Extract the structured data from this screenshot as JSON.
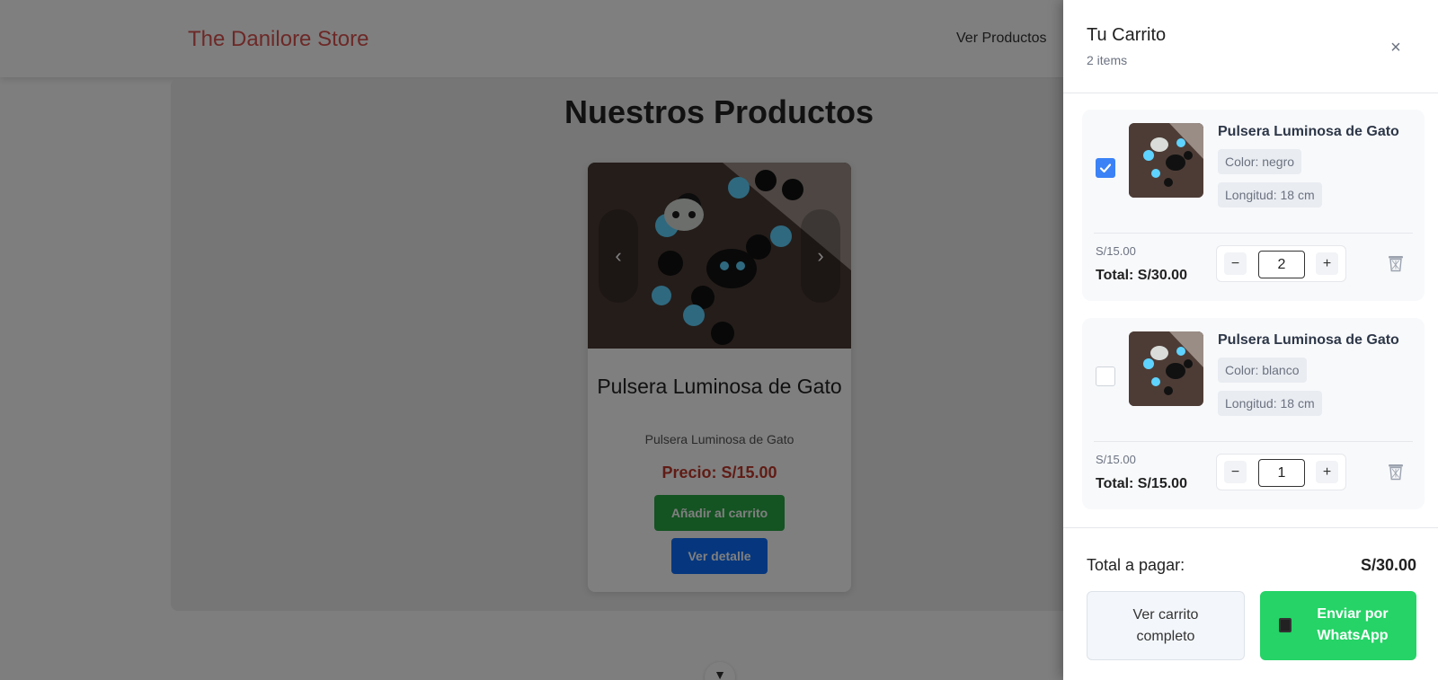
{
  "header": {
    "brand": "The Danilore Store",
    "nav_link": "Ver Productos"
  },
  "main": {
    "section_title": "Nuestros Productos",
    "product": {
      "title": "Pulsera Luminosa de Gato",
      "description": "Pulsera Luminosa de Gato",
      "price": "Precio: S/15.00",
      "add_label": "Añadir al carrito",
      "detail_label": "Ver detalle",
      "prev_glyph": "‹",
      "next_glyph": "›"
    },
    "scroll_glyph": "▼"
  },
  "cart": {
    "title": "Tu Carrito",
    "item_count": "2 items",
    "close_glyph": "×",
    "items": [
      {
        "name": "Pulsera Luminosa de Gato",
        "color": "Color: negro",
        "length": "Longitud: 18 cm",
        "unit_price": "S/15.00",
        "total": "Total: S/30.00",
        "quantity": "2",
        "selected": true
      },
      {
        "name": "Pulsera Luminosa de Gato",
        "color": "Color: blanco",
        "length": "Longitud: 18 cm",
        "unit_price": "S/15.00",
        "total": "Total: S/15.00",
        "quantity": "1",
        "selected": false
      }
    ],
    "minus_glyph": "−",
    "plus_glyph": "+",
    "total_label": "Total a pagar:",
    "total_value": "S/30.00",
    "view_cart_label": "Ver carrito completo",
    "whatsapp_label": "Enviar por WhatsApp"
  },
  "colors": {
    "brand": "#d9534f",
    "add_button": "#28a745",
    "detail_button": "#0d6efd",
    "whatsapp": "#25d366",
    "checkbox": "#3b82f6"
  },
  "icons": [
    "chevron-left-icon",
    "chevron-right-icon",
    "close-icon",
    "check-icon",
    "trash-icon",
    "phone-icon",
    "chevron-down-icon"
  ]
}
